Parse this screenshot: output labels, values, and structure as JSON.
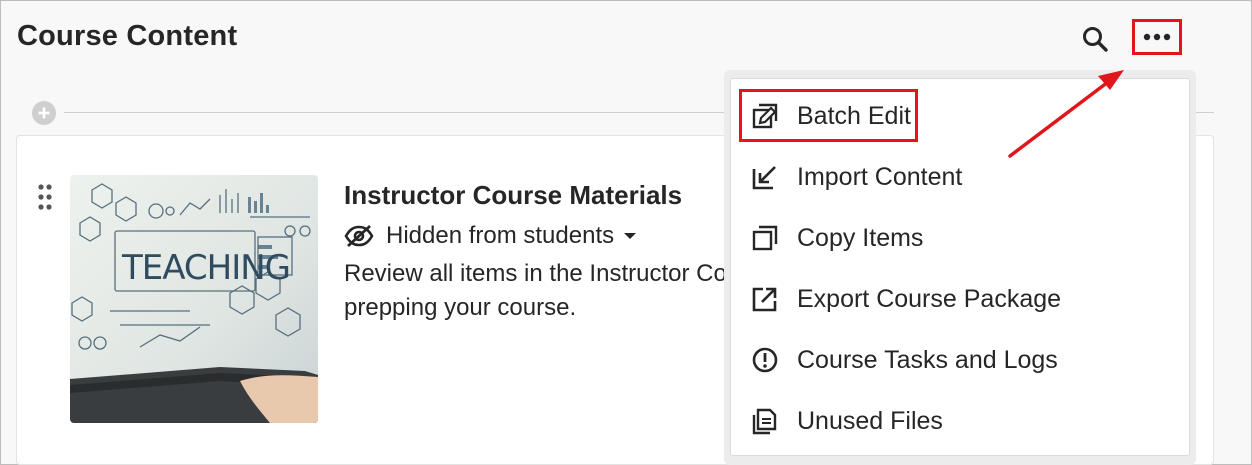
{
  "header": {
    "title": "Course Content",
    "search_icon": "search-icon",
    "more_icon": "more-options-icon"
  },
  "divider": {
    "add_icon": "plus-icon"
  },
  "item": {
    "title": "Instructor Course Materials",
    "visibility_label": "Hidden from students",
    "visibility_icon": "hidden-eye-icon",
    "description_line1": "Review all items in the Instructor Co",
    "description_line2": "prepping your course.",
    "thumbnail_text": "TEACHING"
  },
  "menu": {
    "items": [
      {
        "label": "Batch Edit",
        "icon": "batch-edit-icon"
      },
      {
        "label": "Import Content",
        "icon": "import-icon"
      },
      {
        "label": "Copy Items",
        "icon": "copy-icon"
      },
      {
        "label": "Export Course Package",
        "icon": "export-icon"
      },
      {
        "label": "Course Tasks and Logs",
        "icon": "alert-circle-icon"
      },
      {
        "label": "Unused Files",
        "icon": "files-icon"
      }
    ]
  },
  "colors": {
    "highlight": "#e0161c",
    "text": "#262626",
    "background": "#f8f8f8"
  }
}
